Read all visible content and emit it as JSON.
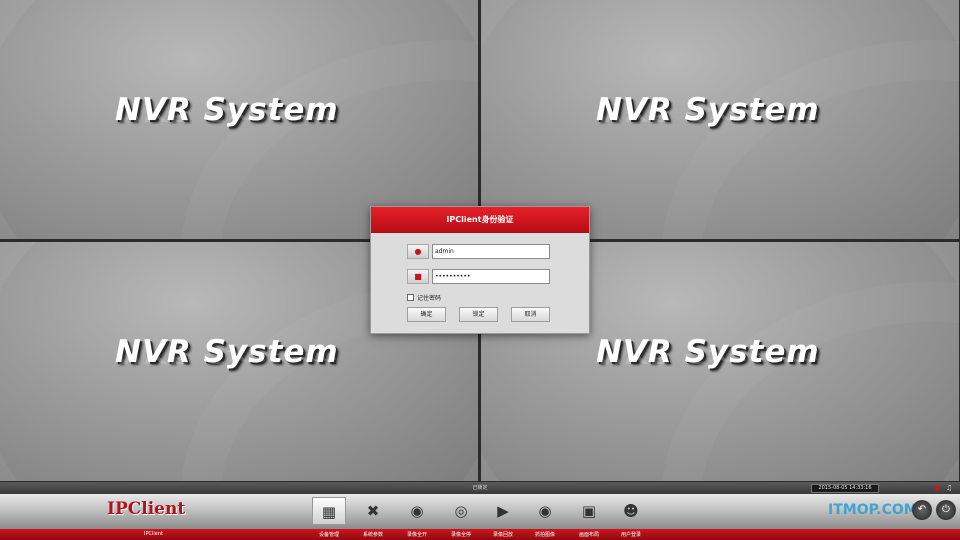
{
  "panes": [
    {
      "logo": "NVR System"
    },
    {
      "logo": "NVR System"
    },
    {
      "logo": "NVR System"
    },
    {
      "logo": "NVR System"
    }
  ],
  "login": {
    "title": "IPClient身份验证",
    "username": "admin",
    "password": "••••••••••",
    "remember_label": "记住密码",
    "buttons": {
      "ok": "确定",
      "lock": "锁定",
      "cancel": "取消"
    }
  },
  "status": {
    "center_text": "已锁定",
    "datetime": "2015-08-05 14:33:16"
  },
  "toolbar": {
    "brand": "IPClient",
    "app_label": "IPClient",
    "items": [
      {
        "label": "设备管理",
        "icon": "device-management-icon"
      },
      {
        "label": "系统参数",
        "icon": "tools-icon"
      },
      {
        "label": "录像全开",
        "icon": "record-all-on-icon"
      },
      {
        "label": "录像全停",
        "icon": "record-all-off-icon"
      },
      {
        "label": "录像回放",
        "icon": "playback-icon"
      },
      {
        "label": "抓拍图像",
        "icon": "camera-icon"
      },
      {
        "label": "画面布局",
        "icon": "layout-icon"
      },
      {
        "label": "用户登录",
        "icon": "user-login-icon"
      }
    ]
  },
  "watermark": "ITMOP.COM",
  "colors": {
    "accent": "#c4161c",
    "titlebar": "#d81a22"
  }
}
